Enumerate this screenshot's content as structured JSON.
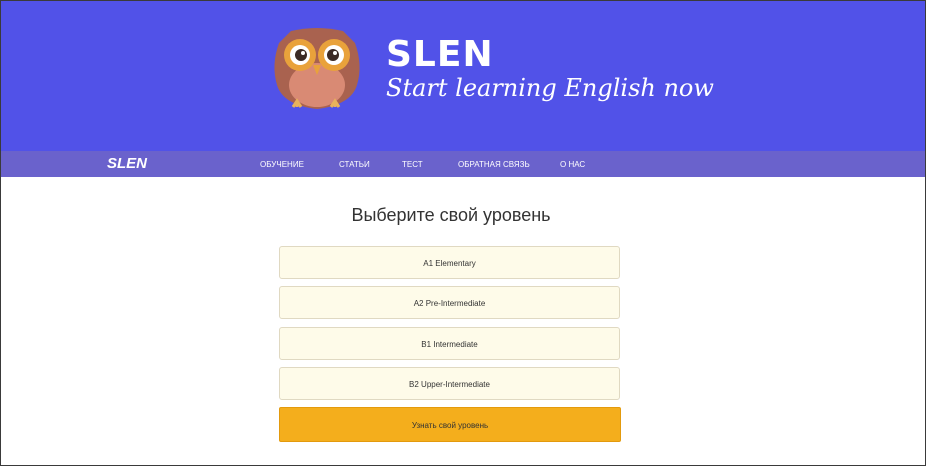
{
  "header": {
    "brand": "SLEN",
    "tagline": "Start learning English now",
    "logo_icon": "owl-logo-icon",
    "background_color": "#5152e8"
  },
  "nav": {
    "logo": "SLEN",
    "items": [
      {
        "label": "ОБУЧЕНИЕ"
      },
      {
        "label": "СТАТЬИ"
      },
      {
        "label": "ТЕСТ"
      },
      {
        "label": "ОБРАТНАЯ СВЯЗЬ"
      },
      {
        "label": "О НАС"
      }
    ],
    "background_color": "#6a62cc"
  },
  "main": {
    "title": "Выберите свой уровень",
    "levels": [
      {
        "label": "A1 Elementary"
      },
      {
        "label": "A2 Pre-Intermediate"
      },
      {
        "label": "B1 Intermediate"
      },
      {
        "label": "B2 Upper-Intermediate"
      }
    ],
    "cta_label": "Узнать свой уровень",
    "cta_color": "#f4ae1c"
  }
}
